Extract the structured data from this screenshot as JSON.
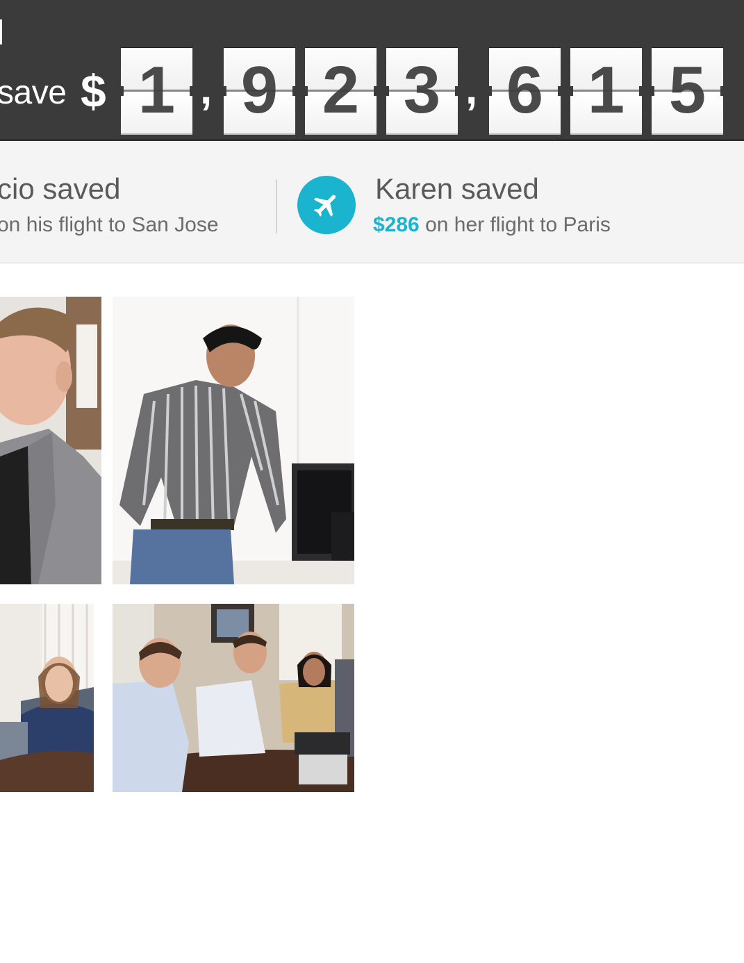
{
  "counter": {
    "save_label": "save",
    "currency": "$",
    "digits": [
      "1",
      "9",
      "2",
      "3",
      "6",
      "1",
      "5"
    ],
    "separators": [
      ",",
      ","
    ]
  },
  "ticker": {
    "left_item": {
      "name": "cio saved",
      "detail": "on his flight to San Jose"
    },
    "right_item": {
      "icon": "airplane-icon",
      "name": "Karen saved",
      "amount": "$286",
      "detail": " on her flight to Paris"
    }
  },
  "colors": {
    "header_background": "#3b3b3b",
    "accent": "#1ab4cf",
    "ticker_background": "#f4f4f4"
  },
  "photos": [
    {
      "subject": "man in grey blazer smiling"
    },
    {
      "subject": "man in striped shirt leaning over computer monitor"
    },
    {
      "subject": "woman seated at conference table"
    },
    {
      "subject": "team seated around conference table"
    }
  ]
}
